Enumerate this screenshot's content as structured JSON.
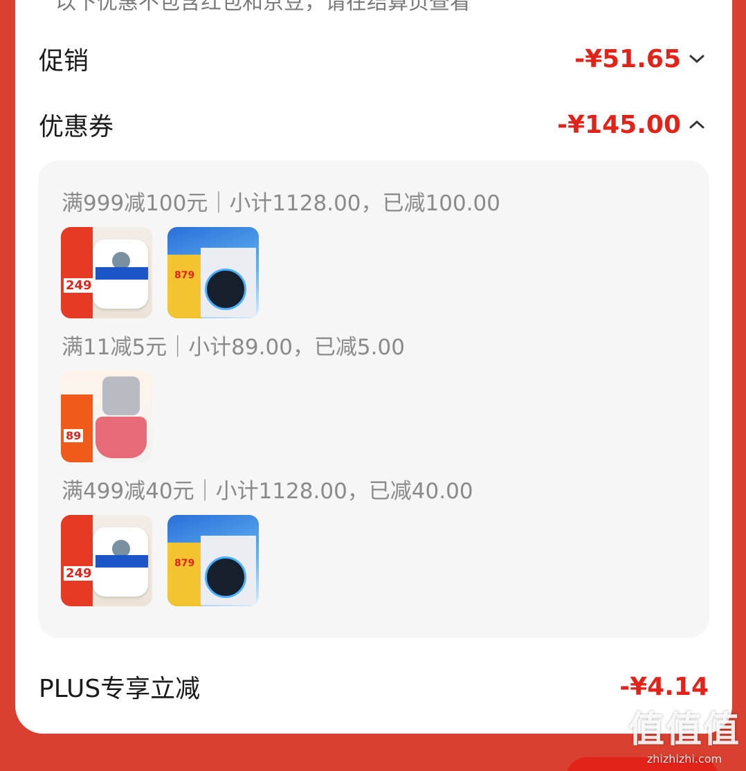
{
  "header_text": "以下优惠不包含红包和京豆，请在结算页查看",
  "promotion": {
    "label": "促销",
    "amount": "-¥51.65",
    "chevron": "chevron-down-icon"
  },
  "coupon": {
    "label": "优惠券",
    "amount": "-¥145.00",
    "chevron": "chevron-up-icon"
  },
  "coupon_groups": [
    {
      "title": "满999减100元｜小计1128.00，已减100.00",
      "products": [
        "water-heater-6l",
        "gas-water-heater-16l"
      ]
    },
    {
      "title": "满11减5元｜小计89.00，已减5.00",
      "products": [
        "meat-chopper"
      ]
    },
    {
      "title": "满499减40元｜小计1128.00，已减40.00",
      "products": [
        "water-heater-6l",
        "gas-water-heater-16l"
      ]
    }
  ],
  "product_prices": {
    "water_heater": "249",
    "gas_heater": "879",
    "chopper": "89"
  },
  "plus": {
    "label": "PLUS专享立减",
    "amount": "-¥4.14"
  },
  "watermark": {
    "big": "值值值",
    "small": "zhizhizhi.com"
  },
  "colors": {
    "accent": "#e2231a",
    "page_bg": "#d9402f",
    "panel_bg": "#f6f6f6"
  }
}
